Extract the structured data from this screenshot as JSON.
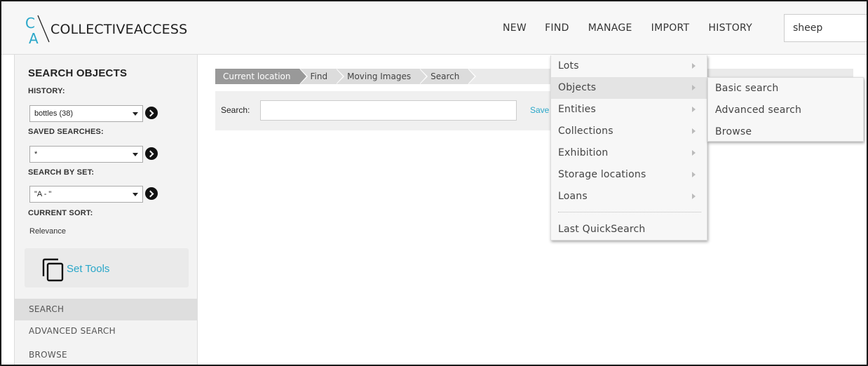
{
  "app": {
    "logo_text": "COLLECTIVEACCESS"
  },
  "topnav": {
    "items": [
      "NEW",
      "FIND",
      "MANAGE",
      "IMPORT",
      "HISTORY"
    ],
    "quicksearch_value": "sheep"
  },
  "sidebar": {
    "title": "SEARCH OBJECTS",
    "history_label": "HISTORY:",
    "history_value": "bottles (38)",
    "saved_searches_label": "SAVED SEARCHES:",
    "saved_searches_value": "*",
    "search_by_set_label": "SEARCH BY SET:",
    "search_by_set_value": "\"A - \"",
    "current_sort_label": "CURRENT SORT:",
    "current_sort_value": "Relevance",
    "set_tools_label": "Set Tools",
    "nav": [
      "SEARCH",
      "ADVANCED SEARCH",
      "BROWSE"
    ],
    "nav_active": "SEARCH"
  },
  "breadcrumb": [
    "Current location",
    "Find",
    "Moving Images",
    "Search"
  ],
  "searchbar": {
    "label": "Search:",
    "value": "",
    "save_label": "Save"
  },
  "find_menu": {
    "items": [
      "Lots",
      "Objects",
      "Entities",
      "Collections",
      "Exhibition",
      "Storage locations",
      "Loans"
    ],
    "highlighted": "Objects",
    "after_separator": "Last QuickSearch"
  },
  "objects_submenu": {
    "items": [
      "Basic search",
      "Advanced search",
      "Browse"
    ]
  },
  "colors": {
    "accent": "#2aa7c9",
    "breadcrumb_current": "#999999"
  }
}
